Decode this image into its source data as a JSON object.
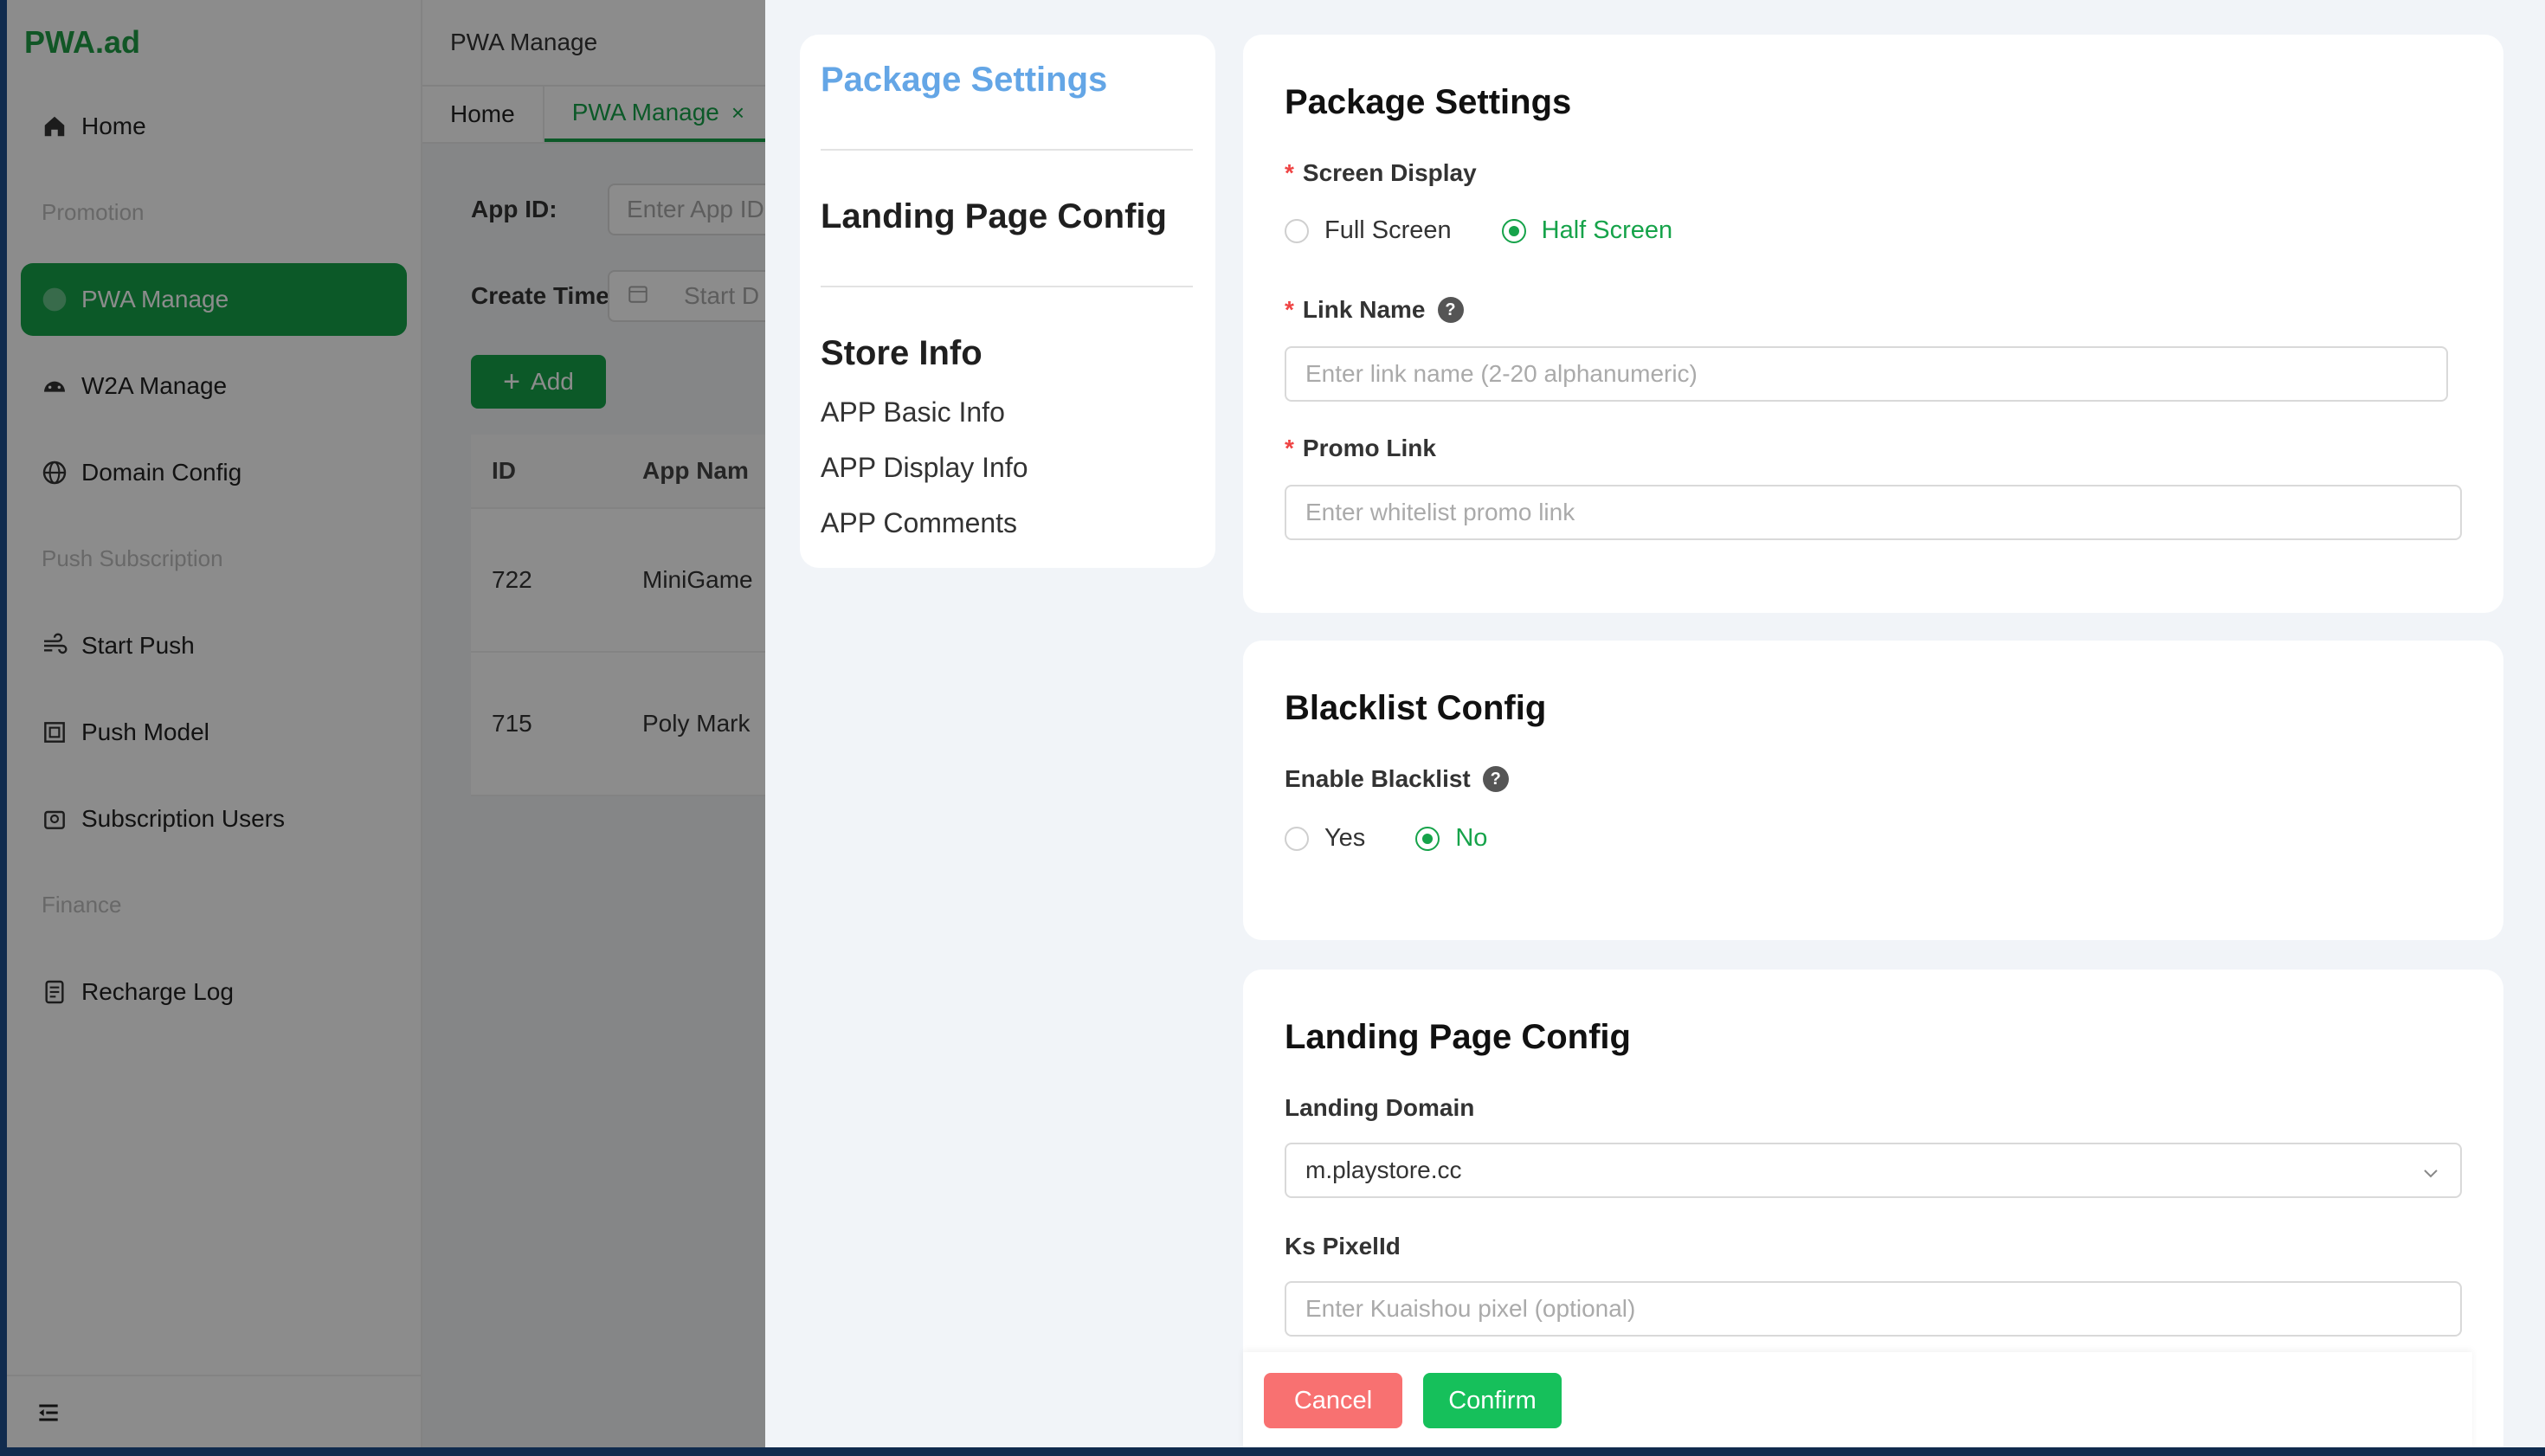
{
  "sidebar": {
    "logo": "PWA.ad",
    "items": [
      {
        "label": "Home",
        "icon": "home-icon"
      },
      {
        "group": "Promotion"
      },
      {
        "label": "PWA Manage",
        "icon": "android-icon",
        "active": true
      },
      {
        "label": "W2A Manage",
        "icon": "android-icon"
      },
      {
        "label": "Domain Config",
        "icon": "globe-icon"
      },
      {
        "group": "Push Subscription"
      },
      {
        "label": "Start Push",
        "icon": "wind-icon"
      },
      {
        "label": "Push Model",
        "icon": "template-icon"
      },
      {
        "label": "Subscription Users",
        "icon": "users-icon"
      },
      {
        "group": "Finance"
      },
      {
        "label": "Recharge Log",
        "icon": "document-icon"
      }
    ]
  },
  "header": {
    "title": "PWA Manage",
    "tabs": [
      {
        "label": "Home"
      },
      {
        "label": "PWA Manage",
        "active": true,
        "close": "×"
      }
    ]
  },
  "filters": {
    "app_id_label": "App ID:",
    "app_id_placeholder": "Enter App ID",
    "create_time_label": "Create Time",
    "start_placeholder": "Start D"
  },
  "toolbar": {
    "add_label": "Add"
  },
  "table": {
    "columns": [
      "ID",
      "App Nam"
    ],
    "rows": [
      {
        "id": "722",
        "name": "MiniGame"
      },
      {
        "id": "715",
        "name": "Poly Mark"
      }
    ]
  },
  "drawer": {
    "anchor": {
      "items": [
        "Package Settings",
        "Landing Page Config",
        "Store Info"
      ],
      "sub": [
        "APP Basic Info",
        "APP Display Info",
        "APP Comments"
      ]
    },
    "package": {
      "title": "Package Settings",
      "screen_display_label": "Screen Display",
      "screen_options": [
        "Full Screen",
        "Half Screen"
      ],
      "screen_selected": "Half Screen",
      "link_name_label": "Link Name",
      "link_name_placeholder": "Enter link name (2-20 alphanumeric)",
      "promo_link_label": "Promo Link",
      "promo_link_placeholder": "Enter whitelist promo link",
      "required_mark": "*",
      "help_mark": "?"
    },
    "blacklist": {
      "title": "Blacklist Config",
      "enable_label": "Enable Blacklist",
      "options": [
        "Yes",
        "No"
      ],
      "selected": "No"
    },
    "landing": {
      "title": "Landing Page Config",
      "domain_label": "Landing Domain",
      "domain_value": "m.playstore.cc",
      "pixel_label": "Ks PixelId",
      "pixel_placeholder": "Enter Kuaishou pixel (optional)"
    },
    "footer": {
      "cancel": "Cancel",
      "confirm": "Confirm"
    }
  },
  "colors": {
    "brand_green": "#16a34a",
    "accent_blue": "#64a6e6",
    "danger": "#f87171",
    "confirm_green": "#16c05b"
  }
}
